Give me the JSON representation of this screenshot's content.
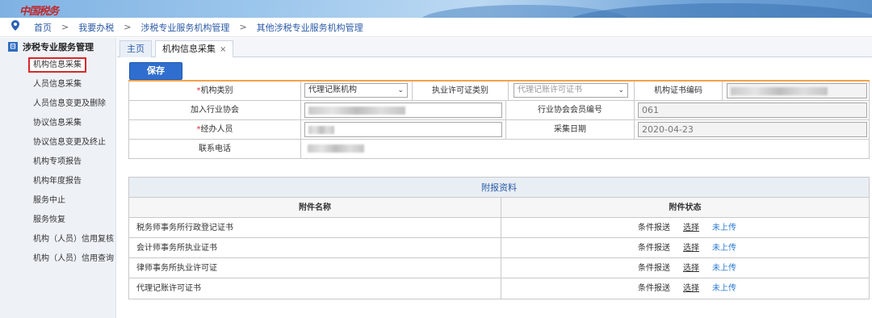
{
  "header": {
    "logo_text": "中国税务"
  },
  "breadcrumb": [
    "首页",
    "我要办税",
    "涉税专业服务机构管理",
    "其他涉税专业服务机构管理"
  ],
  "breadcrumb_sep": ">",
  "sidebar": {
    "title": "涉税专业服务管理",
    "items": [
      "机构信息采集",
      "人员信息采集",
      "人员信息变更及删除",
      "协议信息采集",
      "协议信息变更及终止",
      "机构专项报告",
      "机构年度报告",
      "服务中止",
      "服务恢复",
      "机构（人员）信用复核",
      "机构（人员）信用查询"
    ]
  },
  "tabs": [
    {
      "label": "主页"
    },
    {
      "label": "机构信息采集",
      "close": "×"
    }
  ],
  "toolbar": {
    "save_label": "保存"
  },
  "form": {
    "org_type_label": "机构类别",
    "org_type_value": "代理记账机构",
    "license_type_label": "执业许可证类别",
    "license_type_value": "代理记账许可证书",
    "cert_no_label": "机构证书编码",
    "assoc_label": "加入行业协会",
    "member_no_label": "行业协会会员编号",
    "member_no_value": "061",
    "handler_label": "经办人员",
    "collect_date_label": "采集日期",
    "collect_date_value": "2020-04-23",
    "phone_label": "联系电话",
    "required_mark": "*"
  },
  "attachments": {
    "title": "附报资料",
    "col_name": "附件名称",
    "col_status": "附件状态",
    "rows": [
      {
        "name": "税务师事务所行政登记证书",
        "cond": "条件报送",
        "choose": "选择",
        "status": "未上传"
      },
      {
        "name": "会计师事务所执业证书",
        "cond": "条件报送",
        "choose": "选择",
        "status": "未上传"
      },
      {
        "name": "律师事务所执业许可证",
        "cond": "条件报送",
        "choose": "选择",
        "status": "未上传"
      },
      {
        "name": "代理记账许可证书",
        "cond": "条件报送",
        "choose": "选择",
        "status": "未上传"
      }
    ]
  }
}
